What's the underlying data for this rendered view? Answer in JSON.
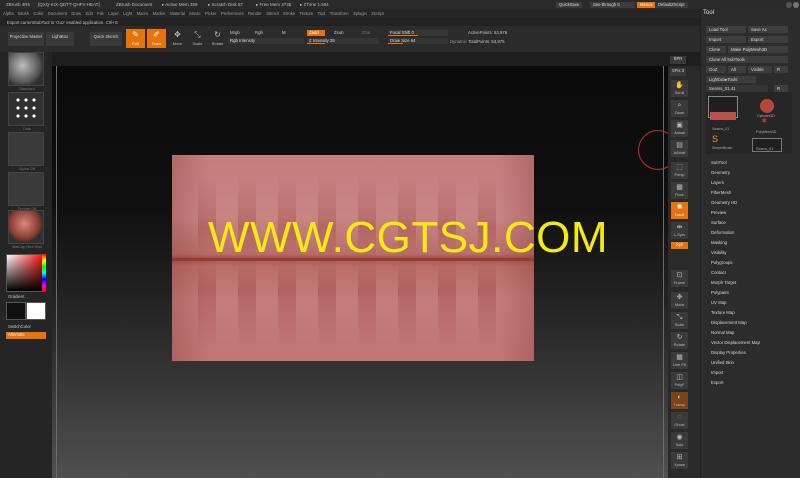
{
  "titlebar": {
    "app": "ZBrush 4R6",
    "build": "[QXQ-KIX-QDTT-QHFV-HEAT]",
    "document": "ZBrush Document",
    "active_mem": "▸ Active Mem 359",
    "scratch_disk": "▸ Scratch Disk 87",
    "free_mem": "▸ Free Mem 3735",
    "ztime": "▸ ZTime 1.594"
  },
  "topright": {
    "quicksave": "QuickSave",
    "see_through": "See-through 0",
    "see_through_value": 0,
    "menus": "Menus",
    "default_script": "DefaultZScript"
  },
  "menubar": [
    "Alpha",
    "Brush",
    "Color",
    "Document",
    "Draw",
    "Edit",
    "File",
    "Layer",
    "Light",
    "Macro",
    "Marker",
    "Material",
    "Movie",
    "Picker",
    "Preferences",
    "Render",
    "Stencil",
    "Stroke",
    "Texture",
    "Tool",
    "Transform",
    "Zplugin",
    "Zscript"
  ],
  "notice": "Export currentSubTool to 'Goz' enabled application. Ctrl+G",
  "shelf": {
    "projection_master": "Projection Master",
    "lightbox": "LightBox",
    "quick_sketch": "Quick Sketch",
    "edit": "Edit",
    "draw": "Draw",
    "move": "Move",
    "scale": "Scale",
    "rotate": "Rotate",
    "mrgb": "Mrgb",
    "rgb": "Rgb",
    "m": "M",
    "rgb_intensity": "Rgb Intensity",
    "zadd": "Zadd",
    "zsub": "Zsub",
    "zcut": "Zcut",
    "z_intensity": "Z Intensity 25",
    "z_intensity_value": 25,
    "focal_shift": "Focal Shift 0",
    "focal_shift_value": 0,
    "draw_size": "Draw Size 64",
    "draw_size_value": 64,
    "dynamic": "Dynamic",
    "active_points": "ActivePoints: 53,976",
    "total_points": "TotalPoints: 53,976"
  },
  "leftshelf": {
    "thumbs": [
      "Standard",
      "Dots",
      "Alpha Off",
      "Texture Off",
      "MatCap Red Wax"
    ],
    "gradient": "Gradient",
    "switchcolor": "SwitchColor",
    "alternate": "Alternate"
  },
  "canvas": {
    "watermark": "WWW.CGTSJ.COM"
  },
  "rightshelf": {
    "items": [
      "BPR",
      "SPix 3",
      "Scroll",
      "Zoom",
      "Actual",
      "AAHalf",
      "Persp",
      "Floor",
      "Local",
      "L.Sym",
      "Xyz",
      "Frame",
      "Move",
      "Scale",
      "Rotate",
      "Line Fill",
      "PolyF",
      "Transp",
      "Ghost",
      "Solo",
      "Xpose"
    ]
  },
  "tool": {
    "title": "Tool",
    "load": "Load Tool",
    "save_as": "Save As",
    "import": "Import",
    "export": "Export",
    "clone": "Clone",
    "make_polymesh": "Make PolyMesh3D",
    "clone_all": "Clone All SubTools",
    "goz": "GoZ",
    "all": "All",
    "visible": "Visible",
    "r": "R",
    "lightbox_tools": "Lightbox▸Tools",
    "current": "Seams_01.41",
    "subtools": [
      "Seams_01",
      "Cylinder3D",
      "PolyMesh3D",
      "SimpleBrush",
      "Seams_01"
    ],
    "sections": [
      "SubTool",
      "Geometry",
      "Layers",
      "FiberMesh",
      "Geometry HD",
      "Preview",
      "Surface",
      "Deformation",
      "Masking",
      "Visibility",
      "Polygroups",
      "Contact",
      "Morph Target",
      "Polypaint",
      "UV Map",
      "Texture Map",
      "Displacement Map",
      "Normal Map",
      "Vector Displacement Map",
      "Display Properties",
      "Unified Skin",
      "Import",
      "Export"
    ]
  },
  "colors": {
    "accent": "#e8730c",
    "mesh": "#c47e7c",
    "watermark": "#f3ea14"
  }
}
